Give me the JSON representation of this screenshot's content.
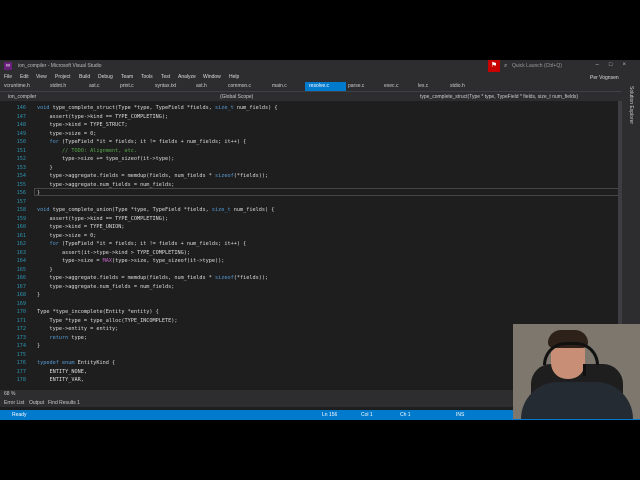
{
  "window": {
    "title": "ion_compiler - Microsoft Visual Studio",
    "quick_launch": "Quick Launch (Ctrl+Q)",
    "user": "Per Vognsen"
  },
  "menu": [
    "File",
    "Edit",
    "View",
    "Project",
    "Build",
    "Debug",
    "Team",
    "Tools",
    "Test",
    "Analyze",
    "Window",
    "Help"
  ],
  "tabs": [
    "vcruntime.h",
    "stdint.h",
    "ast.c",
    "print.c",
    "syntax.txt",
    "ast.h",
    "common.c",
    "main.c",
    "resolve.c",
    "parse.c",
    "exec.c",
    "lex.c",
    "stdio.h"
  ],
  "active_tab": "resolve.c",
  "nav": {
    "project": "ion_compiler",
    "scope": "(Global Scope)",
    "function": "type_complete_struct(Type * type, TypeField * fields, size_t num_fields)"
  },
  "solution_explorer": "Solution Explorer",
  "code": {
    "line_numbers": [
      "146",
      "147",
      "148",
      "149",
      "150",
      "151",
      "152",
      "153",
      "154",
      "155",
      "156",
      "157",
      "158",
      "159",
      "160",
      "161",
      "162",
      "163",
      "164",
      "165",
      "166",
      "167",
      "168",
      "169",
      "170",
      "171",
      "172",
      "173",
      "174",
      "175",
      "176",
      "177",
      "178"
    ],
    "lines": [
      "void type_complete_struct(Type *type, TypeField *fields, size_t num_fields) {",
      "    assert(type->kind == TYPE_COMPLETING);",
      "    type->kind = TYPE_STRUCT;",
      "    type->size = 0;",
      "    for (TypeField *it = fields; it != fields + num_fields; it++) {",
      "        // TODO: Alignment, etc.",
      "        type->size += type_sizeof(it->type);",
      "    }",
      "    type->aggregate.fields = memdup(fields, num_fields * sizeof(*fields));",
      "    type->aggregate.num_fields = num_fields;",
      "}",
      "",
      "void type_complete_union(Type *type, TypeField *fields, size_t num_fields) {",
      "    assert(type->kind == TYPE_COMPLETING);",
      "    type->kind = TYPE_UNION;",
      "    type->size = 0;",
      "    for (TypeField *it = fields; it != fields + num_fields; it++) {",
      "        assert(it->type->kind > TYPE_COMPLETING);",
      "        type->size = MAX(type->size, type_sizeof(it->type));",
      "    }",
      "    type->aggregate.fields = memdup(fields, num_fields * sizeof(*fields));",
      "    type->aggregate.num_fields = num_fields;",
      "}",
      "",
      "Type *type_incomplete(Entity *entity) {",
      "    Type *type = type_alloc(TYPE_INCOMPLETE);",
      "    type->entity = entity;",
      "    return type;",
      "}",
      "",
      "typedef enum EntityKind {",
      "    ENTITY_NONE,",
      "    ENTITY_VAR,"
    ]
  },
  "zoom": "68 %",
  "bottom_tabs": [
    "Error List",
    "Output",
    "Find Results 1"
  ],
  "status": {
    "state": "Ready",
    "line": "Ln 156",
    "col": "Col 1",
    "ch": "Ch 1",
    "ins": "INS"
  },
  "colors": {
    "accent": "#007acc",
    "keyword": "#569cd6",
    "comment": "#57a64a",
    "param": "#9a9a9a",
    "macro": "#bd63c5"
  }
}
